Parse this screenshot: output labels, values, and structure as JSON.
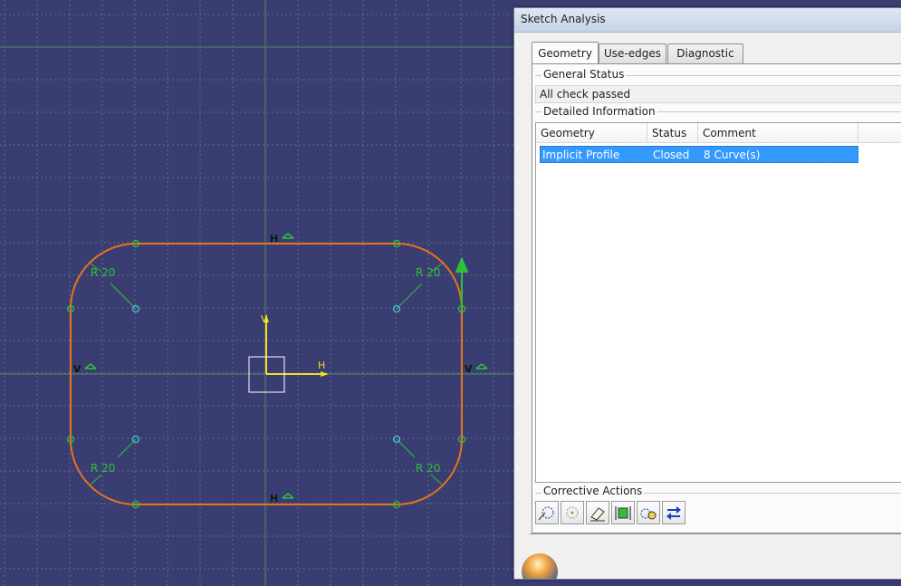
{
  "dialog": {
    "title": "Sketch Analysis",
    "tabs": [
      {
        "label": "Geometry",
        "active": true
      },
      {
        "label": "Use-edges",
        "active": false
      },
      {
        "label": "Diagnostic",
        "active": false
      }
    ],
    "general_status": {
      "label": "General Status",
      "value": "All check passed"
    },
    "detailed_information": {
      "label": "Detailed Information",
      "columns": [
        "Geometry",
        "Status",
        "Comment"
      ],
      "rows": [
        {
          "geometry": "Implicit Profile",
          "status": "Closed",
          "comment": "8 Curve(s)",
          "selected": true
        }
      ]
    },
    "corrective_actions": {
      "label": "Corrective Actions",
      "tools": [
        "open-curve-icon",
        "construction-geometry-icon",
        "erase-icon",
        "hide-constraints-icon",
        "hide-construction-icon",
        "swap-icon"
      ]
    }
  },
  "sketch": {
    "constraint_labels": {
      "radius_top_left": "R 20",
      "radius_top_right": "R 20",
      "radius_bottom_left": "R 20",
      "radius_bottom_right": "R 20",
      "horizontal_top": "H",
      "horizontal_bottom": "H",
      "vertical_left": "V",
      "vertical_right": "V",
      "axis_h": "H",
      "axis_v": "V"
    },
    "colors": {
      "background": "#3a3d72",
      "grid": "#5a6e8a",
      "profile": "#e8731a",
      "constraint": "#2fbf3a",
      "axis": "#f0e020",
      "point": "#40c8d0"
    }
  }
}
